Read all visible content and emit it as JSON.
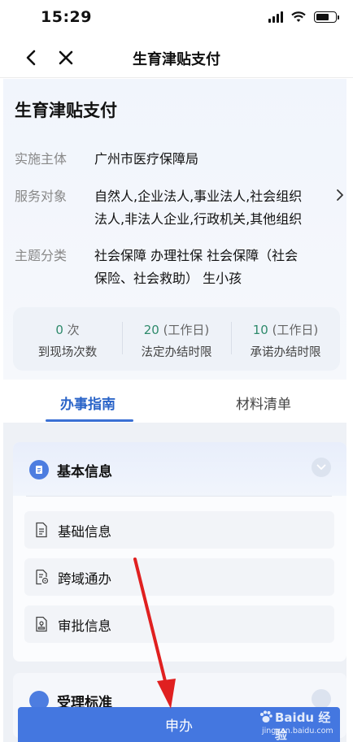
{
  "status_bar": {
    "time": "15:29"
  },
  "nav": {
    "title": "生育津贴支付"
  },
  "service": {
    "title": "生育津贴支付",
    "fields": [
      {
        "label": "实施主体",
        "lines": [
          "广州市医疗保障局"
        ]
      },
      {
        "label": "服务对象",
        "lines": [
          "自然人,企业法人,事业法人,社会组织",
          "法人,非法人企业,行政机关,其他组织"
        ]
      },
      {
        "label": "主题分类",
        "lines": [
          "社会保障 办理社保 社会保障（社会",
          "保险、社会救助） 生小孩"
        ]
      }
    ]
  },
  "stats": [
    {
      "value": "0",
      "unit": "次",
      "label": "到现场次数"
    },
    {
      "value": "20",
      "unit": "(工作日)",
      "label": "法定办结时限"
    },
    {
      "value": "10",
      "unit": "(工作日)",
      "label": "承诺办结时限"
    }
  ],
  "tabs": [
    {
      "label": "办事指南",
      "active": true
    },
    {
      "label": "材料清单",
      "active": false
    }
  ],
  "sections": [
    {
      "title": "基本信息",
      "items": [
        {
          "label": "基础信息",
          "icon": "document-icon"
        },
        {
          "label": "跨域通办",
          "icon": "document-location-icon"
        },
        {
          "label": "审批信息",
          "icon": "document-stamp-icon"
        }
      ]
    },
    {
      "title": "受理标准"
    }
  ],
  "apply_button": {
    "label": "申办"
  },
  "watermark": {
    "brand": "Baidu 经验",
    "url": "jingyan.baidu.com"
  },
  "colors": {
    "accent": "#4477e0",
    "stat_value": "#2e8a6b",
    "arrow": "#e02020"
  }
}
